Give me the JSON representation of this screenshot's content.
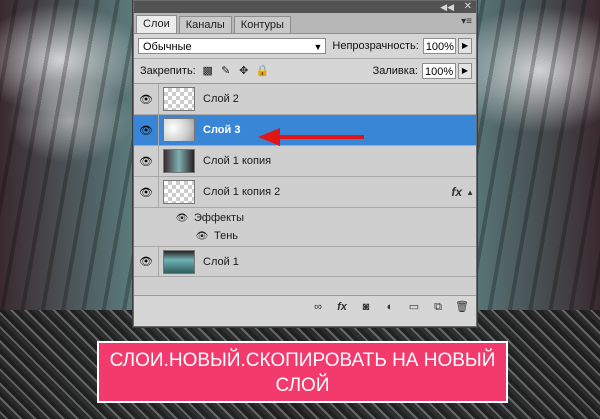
{
  "panel": {
    "tabs": [
      "Слои",
      "Каналы",
      "Контуры"
    ],
    "blend_mode": "Обычные",
    "opacity_label": "Непрозрачность:",
    "opacity_value": "100%",
    "lock_label": "Закрепить:",
    "fill_label": "Заливка:",
    "fill_value": "100%"
  },
  "layers": [
    {
      "name": "Слой 2",
      "selected": false,
      "thumb": "checker"
    },
    {
      "name": "Слой 3",
      "selected": true,
      "thumb": "white"
    },
    {
      "name": "Слой 1 копия",
      "selected": false,
      "thumb": "photo"
    },
    {
      "name": "Слой 1 копия 2",
      "selected": false,
      "thumb": "checker",
      "fx": "fx"
    },
    {
      "name": "Слой 1",
      "selected": false,
      "thumb": "teal"
    }
  ],
  "effects": {
    "group_label": "Эффекты",
    "shadow_label": "Тень"
  },
  "icons": {
    "eye": "eye-icon",
    "link": "link-icon",
    "fx": "fx-icon",
    "mask": "mask-icon",
    "adjustment": "adjustment-icon",
    "folder": "folder-icon",
    "new_layer": "new-layer-icon",
    "trash": "trash-icon"
  },
  "banner": {
    "line1": "СЛОИ.НОВЫЙ.СКОПИРОВАТЬ НА НОВЫЙ",
    "line2": "СЛОЙ"
  },
  "colors": {
    "selection": "#3a86d6",
    "banner": "#f23a6d",
    "arrow": "#e01616"
  }
}
